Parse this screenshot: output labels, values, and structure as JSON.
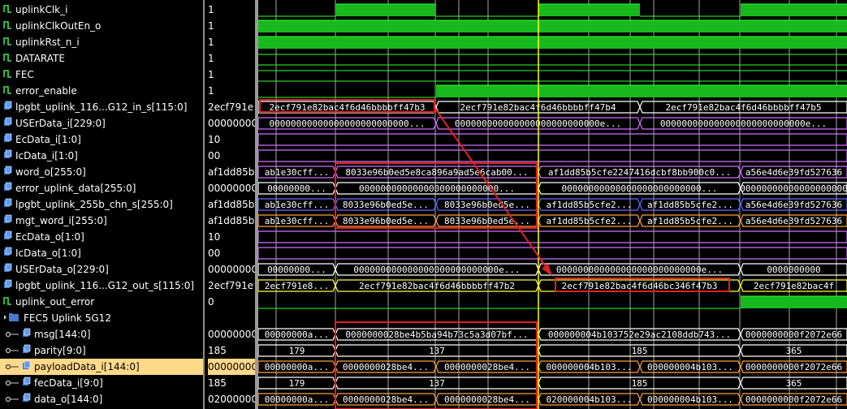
{
  "signals": [
    {
      "name": "uplinkClk_i",
      "value": "1",
      "icon": "bit-signal-icon",
      "indent": 0
    },
    {
      "name": "uplinkClkOutEn_o",
      "value": "1",
      "icon": "bit-signal-icon",
      "indent": 0
    },
    {
      "name": "uplinkRst_n_i",
      "value": "1",
      "icon": "bit-signal-icon",
      "indent": 0
    },
    {
      "name": "DATARATE",
      "value": "1",
      "icon": "bit-signal-icon",
      "indent": 0
    },
    {
      "name": "FEC",
      "value": "1",
      "icon": "bit-signal-icon",
      "indent": 0
    },
    {
      "name": "error_enable",
      "value": "1",
      "icon": "bit-signal-icon",
      "indent": 0
    },
    {
      "name": "lpgbt_uplink_116...G12_in_s[115:0]",
      "value": "2ecf791e",
      "icon": "bus-signal-icon",
      "indent": 0
    },
    {
      "name": "USErData_i[229:0]",
      "value": "00000000",
      "icon": "bus-signal-icon",
      "indent": 0
    },
    {
      "name": "EcData_i[1:0]",
      "value": "10",
      "icon": "bus-signal-icon",
      "indent": 0
    },
    {
      "name": "IcData_i[1:0]",
      "value": "00",
      "icon": "bus-signal-icon",
      "indent": 0
    },
    {
      "name": "word_o[255:0]",
      "value": "af1dd85b",
      "icon": "bus-signal-icon",
      "indent": 0
    },
    {
      "name": "error_uplink_data[255:0]",
      "value": "00000000",
      "icon": "bus-signal-icon",
      "indent": 0
    },
    {
      "name": "lpgbt_uplink_255b_chn_s[255:0]",
      "value": "af1dd85b",
      "icon": "bus-signal-icon",
      "indent": 0
    },
    {
      "name": "mgt_word_i[255:0]",
      "value": "af1dd85b",
      "icon": "bus-signal-icon",
      "indent": 0
    },
    {
      "name": "EcData_o[1:0]",
      "value": "10",
      "icon": "bus-signal-icon",
      "indent": 0
    },
    {
      "name": "IcData_o[1:0]",
      "value": "00",
      "icon": "bus-signal-icon",
      "indent": 0
    },
    {
      "name": "USErData_o[229:0]",
      "value": "00000000",
      "icon": "bus-signal-icon",
      "indent": 0
    },
    {
      "name": "lpgbt_uplink_116...G12_out_s[115:0]",
      "value": "2ecf791e",
      "icon": "bus-signal-icon",
      "indent": 0
    },
    {
      "name": "uplink_out_error",
      "value": "0",
      "icon": "bit-signal-icon",
      "indent": 0
    },
    {
      "name": "FEC5 Uplink 5G12",
      "value": "",
      "icon": "group-folder-icon",
      "indent": 0
    },
    {
      "name": "msg[144:0]",
      "value": "00000000",
      "icon": "bus-signal-icon",
      "indent": 1
    },
    {
      "name": "parity[9:0]",
      "value": "185",
      "icon": "bus-signal-icon",
      "indent": 1
    },
    {
      "name": "payloadData_i[144:0]",
      "value": "00000000",
      "icon": "bus-signal-icon",
      "indent": 1,
      "highlighted": true
    },
    {
      "name": "fecData_i[9:0]",
      "value": "185",
      "icon": "bus-signal-icon",
      "indent": 1
    },
    {
      "name": "data_o[144:0]",
      "value": "02000000",
      "icon": "bus-signal-icon",
      "indent": 1
    }
  ],
  "waves": [
    {
      "kind": "bit",
      "pattern": "clk"
    },
    {
      "kind": "bit",
      "pattern": "high"
    },
    {
      "kind": "bit",
      "pattern": "high"
    },
    {
      "kind": "bit",
      "pattern": "flat"
    },
    {
      "kind": "bit",
      "pattern": "flat"
    },
    {
      "kind": "bit",
      "pattern": "rise"
    },
    {
      "kind": "bus",
      "color": "#ffffff",
      "segs": [
        "2ecf791e82bac4f6d46bbbbff47b3",
        "2ecf791e82bac4f6d46bbbbff47b4",
        "2ecf791e82bac4f6d46bbbbff47b5"
      ]
    },
    {
      "kind": "bus",
      "color": "#d070ff",
      "segs": [
        "00000000000000000000000000...",
        "000000000000000000000000000e...",
        "000000000000000000000000000e..."
      ]
    },
    {
      "kind": "bus",
      "color": "#d070ff",
      "segs": [
        ""
      ]
    },
    {
      "kind": "bus",
      "color": "#d070ff",
      "segs": [
        ""
      ]
    },
    {
      "kind": "bus",
      "color": "#d070ff",
      "segs": [
        "ab1e30cff...",
        "8033e96b0ed5e8ca896a9ad5e6cab00...",
        "af1dd85b5cfe2247416dcbf8bb900c0...",
        "a56e4d6e39fd527636"
      ]
    },
    {
      "kind": "bus",
      "color": "#ffffff",
      "segs": [
        "00000000...",
        "00000000000000000000000000...",
        "00000000000000000000000000...",
        "00000000000000000000"
      ]
    },
    {
      "kind": "bus",
      "color": "#6a6aff",
      "segs": [
        "ab1e30cff...",
        "8033e96b0ed5e...",
        "8033e96b0ed5e...",
        "af1dd85b5cfe2...",
        "af1dd85b5cfe2...",
        "a56e4d6e39fd527636"
      ]
    },
    {
      "kind": "bus",
      "color": "#ffa040",
      "segs": [
        "ab1e30cff...",
        "8033e96b0ed5e...",
        "8033e96b0ed5e...",
        "af1dd85b5cfe2...",
        "af1dd85b5cfe2...",
        "a56e4d6e39fd527636"
      ]
    },
    {
      "kind": "bus",
      "color": "#d070ff",
      "segs": [
        ""
      ]
    },
    {
      "kind": "bus",
      "color": "#d070ff",
      "segs": [
        ""
      ]
    },
    {
      "kind": "bus",
      "color": "#ffffff",
      "segs": [
        "00000000...",
        "000000000000000000000000000e...",
        "000000000000000000000000000e...",
        "0000000000"
      ]
    },
    {
      "kind": "bus",
      "color": "#ffff40",
      "segs": [
        "2ecf791e8...",
        "2ecf791e82bac4f6d46bbbbff47b2",
        "2ecf791e82bac4f6d46bc346f47b3",
        "2ecf791e82bac4f"
      ]
    },
    {
      "kind": "bit",
      "pattern": "low-rise"
    },
    {
      "kind": "none"
    },
    {
      "kind": "bus",
      "color": "#ffffff",
      "segs": [
        "00000000a...",
        "0000000028be4b5ba94b73c5a3d07bf...",
        "000000004b103752e29ac2108ddb743...",
        "0000000000f2072e66"
      ]
    },
    {
      "kind": "bus",
      "color": "#ffffff",
      "segs": [
        "179",
        "137",
        "185",
        "365"
      ]
    },
    {
      "kind": "bus",
      "color": "#ffa040",
      "segs": [
        "00000000a...",
        "0000000028be4...",
        "0000000028be4...",
        "000000004b103...",
        "000000004b103...",
        "0000000000f2072e66"
      ]
    },
    {
      "kind": "bus",
      "color": "#ffffff",
      "segs": [
        "179",
        "137",
        "185",
        "365"
      ]
    },
    {
      "kind": "bus",
      "color": "#ffa040",
      "segs": [
        "00000000a...",
        "0000000028be4...",
        "0000000028be4...",
        "020000004b103...",
        "000000004b103...",
        "0000000000f2072e66"
      ]
    }
  ],
  "colors": {
    "bit_fill": "#17b91e",
    "bit_line": "#2cff2c",
    "cursor": "#ffff00",
    "annot": "#e02020",
    "grid": "#cfcfcf"
  }
}
